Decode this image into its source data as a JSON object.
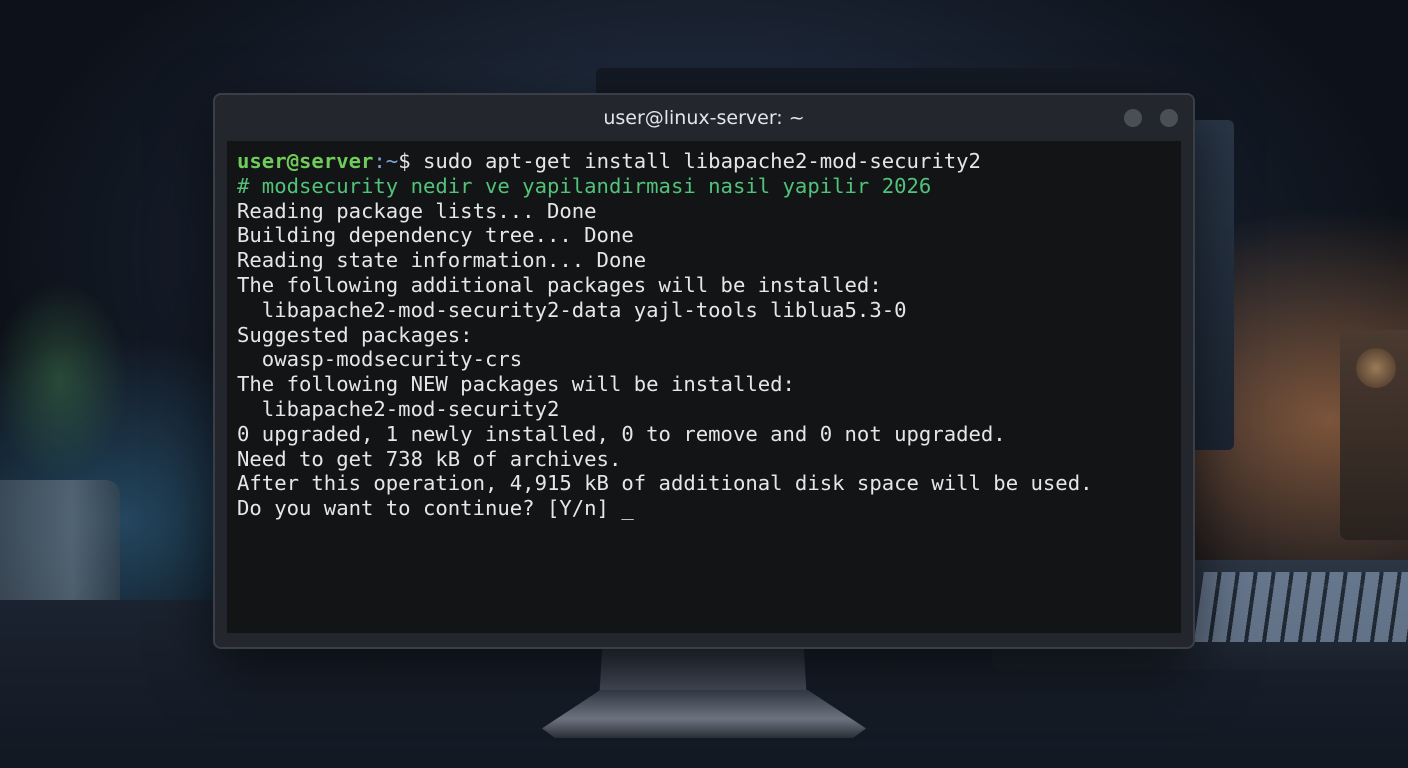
{
  "window": {
    "title": "user@linux-server: ~"
  },
  "terminal": {
    "prompt_user": "user@server",
    "prompt_path": ":~",
    "prompt_symbol": "$ ",
    "command": "sudo apt-get install libapache2-mod-security2",
    "comment": "# modsecurity nedir ve yapilandirmasi nasil yapilir 2026",
    "output_lines": [
      "Reading package lists... Done",
      "Building dependency tree... Done",
      "Reading state information... Done",
      "The following additional packages will be installed:",
      "  libapache2-mod-security2-data yajl-tools liblua5.3-0",
      "Suggested packages:",
      "  owasp-modsecurity-crs",
      "The following NEW packages will be installed:",
      "  libapache2-mod-security2",
      "0 upgraded, 1 newly installed, 0 to remove and 0 not upgraded.",
      "Need to get 738 kB of archives.",
      "After this operation, 4,915 kB of additional disk space will be used."
    ],
    "input_prompt": "Do you want to continue? [Y/n] ",
    "cursor": "_"
  },
  "colors": {
    "prompt_user": "#6fcb5a",
    "prompt_path": "#7ea4d6",
    "comment": "#52c27a",
    "text": "#e4e6e8",
    "background": "#121416"
  }
}
